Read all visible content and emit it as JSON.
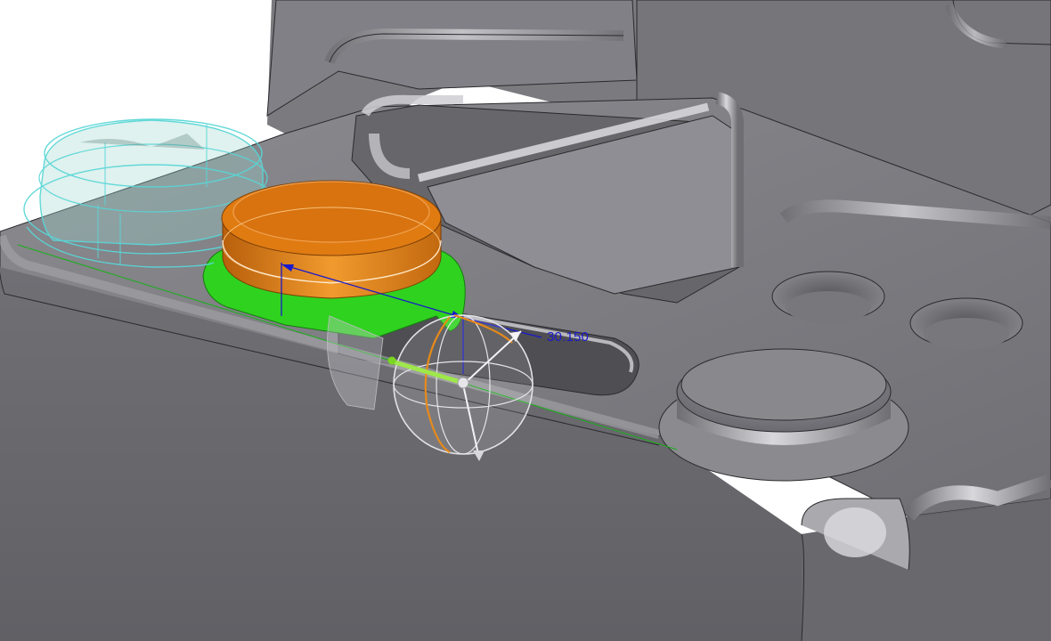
{
  "viewport": {
    "dimension_value": "30.150"
  },
  "colors": {
    "background": "#ffffff",
    "part_body": "#77777c",
    "preview_body": "#e07b12",
    "highlight_face": "#2fd21f",
    "ghost_body": "#5ad6d6",
    "dimension": "#1a1acc",
    "dragger_ring": "#e88a1a",
    "axis_line": "#19b019"
  },
  "icons": {
    "dragger": "move-dragger-icon",
    "arrow": "dimension-arrow-icon"
  }
}
